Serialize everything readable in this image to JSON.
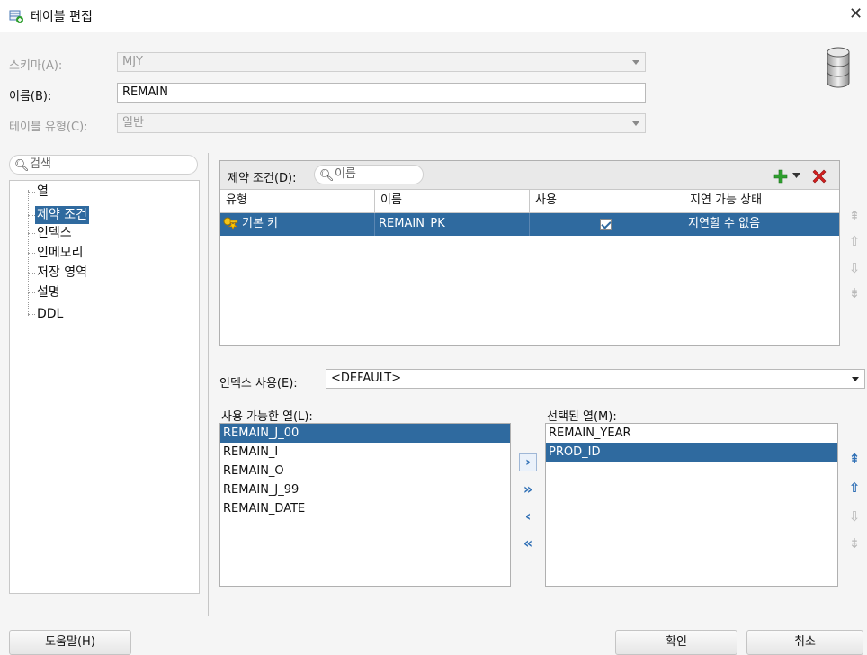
{
  "window": {
    "title": "테이블 편집",
    "close_glyph": "✕"
  },
  "form": {
    "schema_label": "스키마(A):",
    "schema_value": "MJY",
    "name_label": "이름(B):",
    "name_value": "REMAIN",
    "type_label": "테이블 유형(C):",
    "type_value": "일반"
  },
  "nav": {
    "search_placeholder": "검색",
    "items": [
      "열",
      "제약 조건",
      "인덱스",
      "인메모리",
      "저장 영역",
      "설명",
      "DDL"
    ],
    "selected_index": 1
  },
  "constraints": {
    "label": "제약 조건(D):",
    "filter_placeholder": "이름",
    "columns": [
      "유형",
      "이름",
      "사용",
      "지연 가능 상태"
    ],
    "rows": [
      {
        "type": "기본 키",
        "name": "REMAIN_PK",
        "enabled": true,
        "deferrable": "지연할 수 없음"
      }
    ]
  },
  "index": {
    "label": "인덱스 사용(E):",
    "value": "<DEFAULT>"
  },
  "available_columns": {
    "label": "사용 가능한 열(L):",
    "items": [
      "REMAIN_J_00",
      "REMAIN_I",
      "REMAIN_O",
      "REMAIN_J_99",
      "REMAIN_DATE"
    ],
    "selected_index": 0
  },
  "selected_columns": {
    "label": "선택된 열(M):",
    "items": [
      "REMAIN_YEAR",
      "PROD_ID"
    ],
    "selected_index": 1
  },
  "buttons": {
    "help": "도움말(H)",
    "ok": "확인",
    "cancel": "취소"
  },
  "colors": {
    "selection": "#2f6a9f",
    "accent_arrow": "#2f6fb5",
    "add_green": "#2e9e2e",
    "delete_red": "#d32020"
  }
}
